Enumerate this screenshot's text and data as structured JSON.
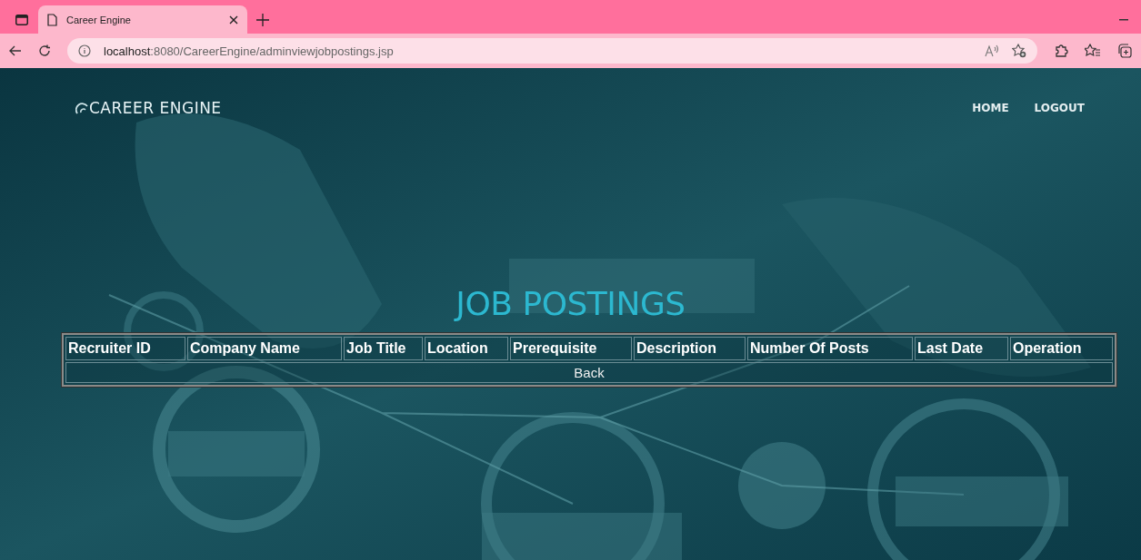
{
  "browser": {
    "tab": {
      "title": "Career Engine"
    },
    "address": {
      "host": "localhost",
      "rest": ":8080/CareerEngine/adminviewjobpostings.jsp"
    }
  },
  "page": {
    "brand": "CAREER ENGINE",
    "nav": [
      {
        "label": "HOME"
      },
      {
        "label": "LOGOUT"
      }
    ],
    "heading": "JOB POSTINGS",
    "table": {
      "columns": [
        {
          "label": "Recruiter ID"
        },
        {
          "label": "Company Name"
        },
        {
          "label": "Job Title"
        },
        {
          "label": "Location"
        },
        {
          "label": "Prerequisite"
        },
        {
          "label": "Description"
        },
        {
          "label": "Number Of Posts"
        },
        {
          "label": "Last Date"
        },
        {
          "label": "Operation"
        }
      ],
      "back_link": "Back"
    }
  }
}
